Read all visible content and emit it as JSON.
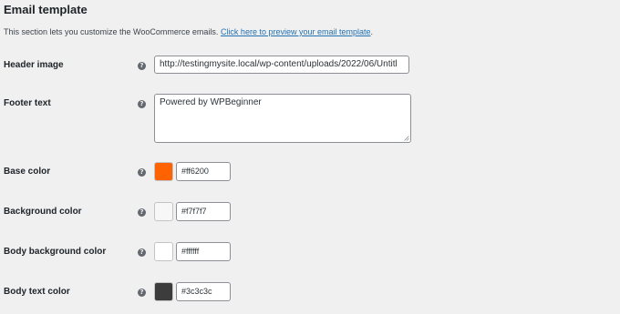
{
  "section": {
    "title": "Email template",
    "description": "This section lets you customize the WooCommerce emails.",
    "preview_link": "Click here to preview your email template"
  },
  "help_glyph": "?",
  "fields": {
    "header_image": {
      "label": "Header image",
      "value": "http://testingmysite.local/wp-content/uploads/2022/06/Untitl"
    },
    "footer_text": {
      "label": "Footer text",
      "value": "Powered by WPBeginner"
    },
    "base_color": {
      "label": "Base color",
      "value": "#ff6200",
      "swatch": "#ff6200"
    },
    "background_color": {
      "label": "Background color",
      "value": "#f7f7f7",
      "swatch": "#f7f7f7"
    },
    "body_background_color": {
      "label": "Body background color",
      "value": "#ffffff",
      "swatch": "#ffffff"
    },
    "body_text_color": {
      "label": "Body text color",
      "value": "#3c3c3c",
      "swatch": "#3c3c3c"
    }
  },
  "icons": {
    "help": "help-icon",
    "resize": "resize-handle-icon"
  },
  "colors": {
    "page_bg": "#f0f0f1",
    "link": "#2271b1",
    "text": "#1d2327"
  }
}
